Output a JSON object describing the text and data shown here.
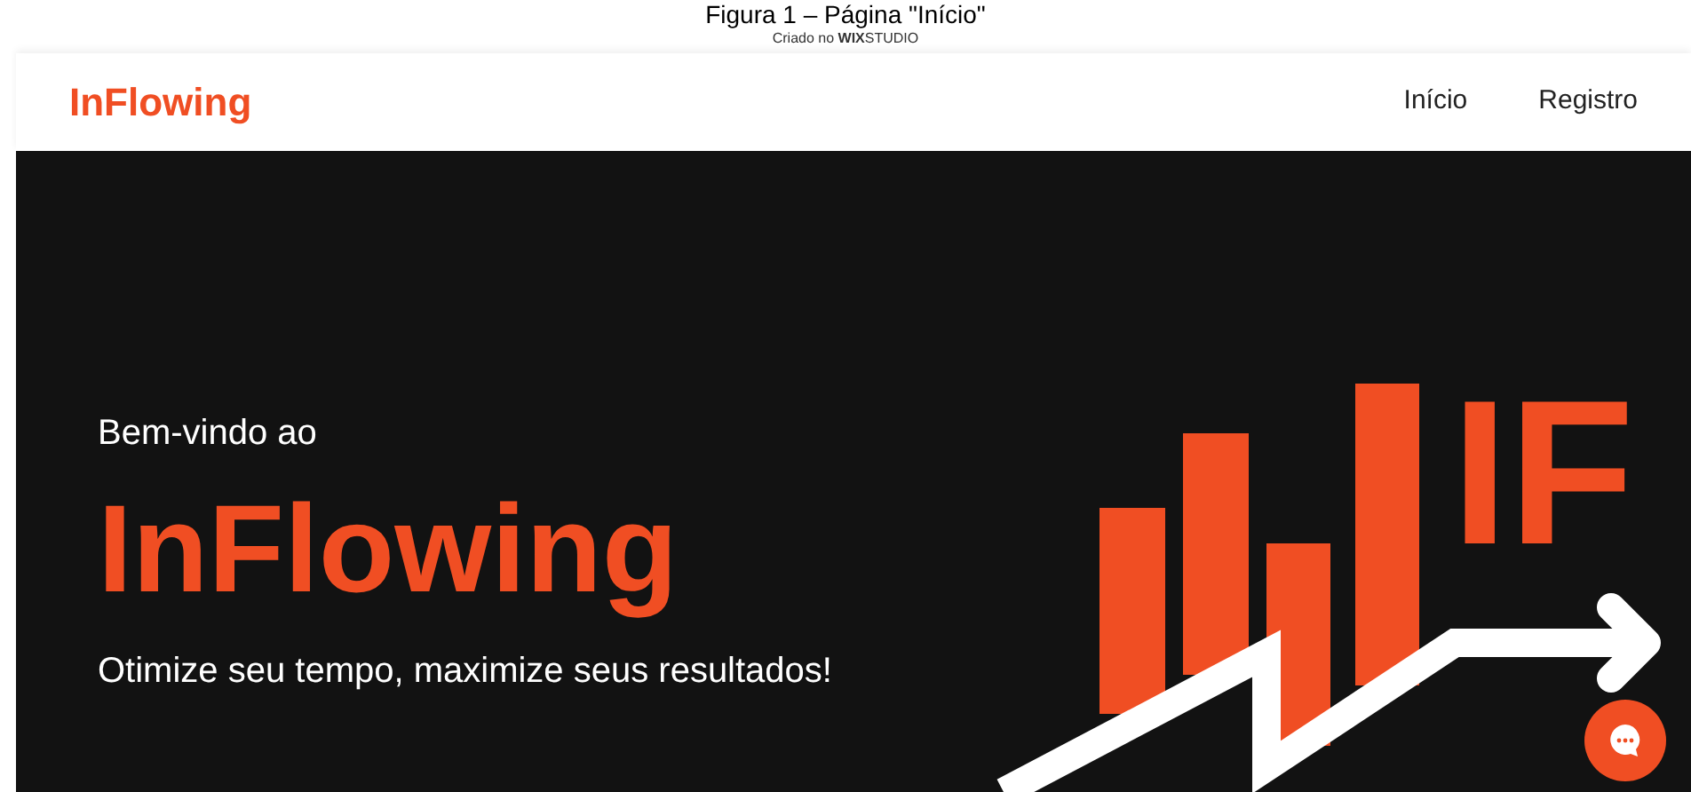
{
  "caption": "Figura 1 – Página \"Início\"",
  "credit": {
    "prefix": "Criado no",
    "brand": "WIX",
    "suffix": "STUDIO"
  },
  "header": {
    "logo": "InFlowing",
    "nav": [
      {
        "label": "Início"
      },
      {
        "label": "Registro"
      }
    ]
  },
  "hero": {
    "greeting": "Bem-vindo ao",
    "title": "InFlowing",
    "tagline": "Otimize seu tempo, maximize seus resultados!",
    "logo_letters": "IF"
  }
}
